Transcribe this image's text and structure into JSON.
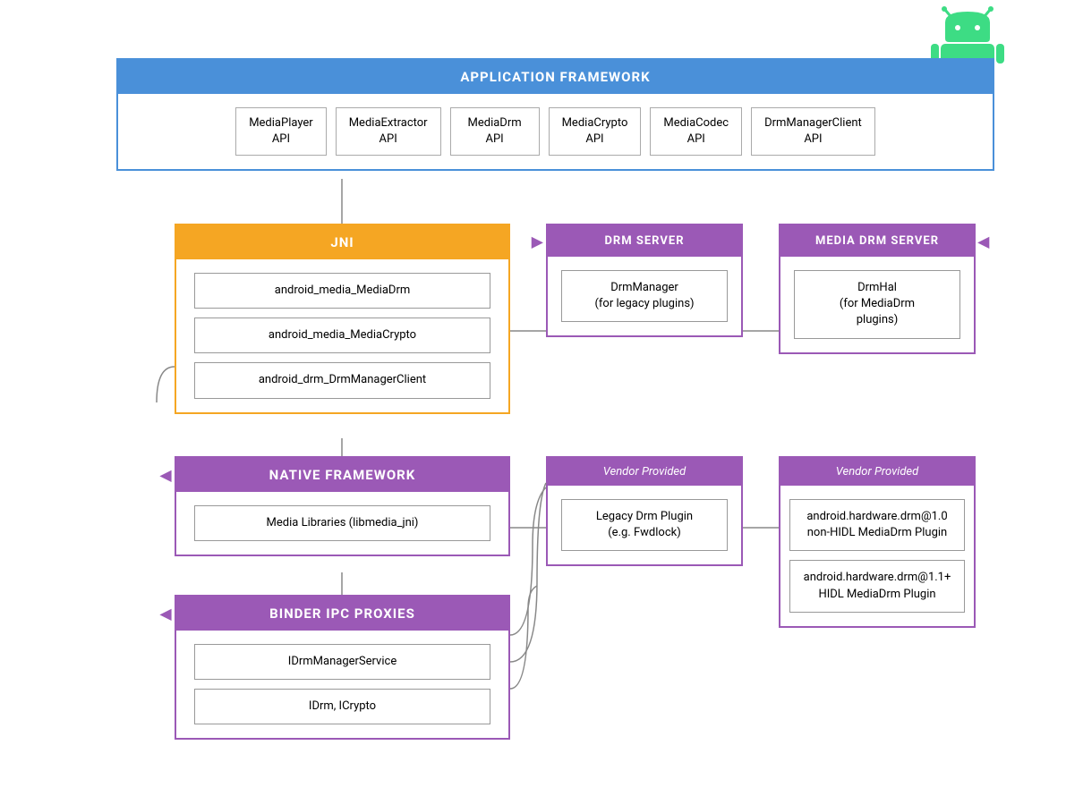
{
  "android_logo": {
    "label": "Android Logo"
  },
  "app_framework": {
    "header": "APPLICATION FRAMEWORK",
    "apis": [
      {
        "name": "MediaPlayer\nAPI"
      },
      {
        "name": "MediaExtractor\nAPI"
      },
      {
        "name": "MediaDrm\nAPI"
      },
      {
        "name": "MediaCrypto\nAPI"
      },
      {
        "name": "MediaCodec\nAPI"
      },
      {
        "name": "DrmManagerClient\nAPI"
      }
    ]
  },
  "jni": {
    "header": "JNI",
    "items": [
      "android_media_MediaDrm",
      "android_media_MediaCrypto",
      "android_drm_DrmManagerClient"
    ]
  },
  "drm_server": {
    "header": "DRM SERVER",
    "items": [
      "DrmManager\n(for legacy plugins)"
    ]
  },
  "media_drm_server": {
    "header": "MEDIA DRM SERVER",
    "items": [
      "DrmHal\n(for MediaDrm\nplugins)"
    ]
  },
  "native_framework": {
    "header": "NATIVE FRAMEWORK",
    "items": [
      "Media Libraries (libmedia_jni)"
    ]
  },
  "vendor_legacy": {
    "header": "Vendor Provided",
    "items": [
      "Legacy Drm Plugin\n(e.g. Fwdlock)"
    ]
  },
  "vendor_hidl": {
    "header": "Vendor Provided",
    "items": [
      "android.hardware.drm@1.0\nnon-HIDL MediaDrm Plugin",
      "android.hardware.drm@1.1+\nHIDL MediaDrm Plugin"
    ]
  },
  "binder": {
    "header": "BINDER IPC PROXIES",
    "items": [
      "IDrmManagerService",
      "IDrm, ICrypto"
    ]
  },
  "colors": {
    "blue": "#4a90d9",
    "orange": "#f5a623",
    "purple": "#9b59b6",
    "android_green": "#3ddc84"
  }
}
